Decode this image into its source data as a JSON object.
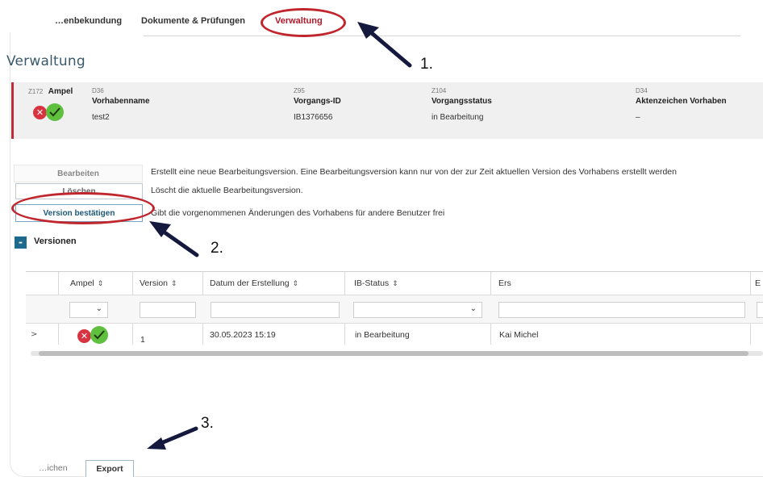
{
  "top_tabs": {
    "tab1": "…enbekundung",
    "tab2": "Dokumente & Prüfungen",
    "tab3": "Verwaltung"
  },
  "page_title": "Verwaltung",
  "info": {
    "ampel_id": "Z172",
    "ampel_label": "Ampel",
    "name_id": "D36",
    "name_label": "Vorhabenname",
    "name_value": "test2",
    "vorgang_id": "Z95",
    "vorgang_label": "Vorgangs-ID",
    "vorgang_value": "IB1376656",
    "status_id": "Z104",
    "status_label": "Vorgangsstatus",
    "status_value": "in Bearbeitung",
    "akten_id": "D34",
    "akten_label": "Aktenzeichen Vorhaben",
    "akten_value": "–"
  },
  "actions": {
    "edit_label": "Bearbeiten",
    "edit_desc": "Erstellt eine neue Bearbeitungsversion. Eine Bearbeitungsversion kann nur von der zur Zeit aktuellen Version des Vorhabens erstellt werden",
    "delete_label": "Löschen",
    "delete_desc": "Löscht die aktuelle Bearbeitungsversion.",
    "confirm_label": "Version bestätigen",
    "confirm_desc": "Gibt die vorgenommenen Änderungen des Vorhabens für andere Benutzer frei"
  },
  "versions": {
    "toggle": "-",
    "title": "Versionen",
    "columns": {
      "ampel": "Ampel",
      "version": "Version",
      "datum": "Datum der Erstellung",
      "ibstatus": "IB-Status",
      "ers": "Ers",
      "more": "E"
    },
    "sort_glyph": "⇕",
    "row": {
      "expander": ">",
      "version": "1",
      "datum": "30.05.2023 15:19",
      "ibstatus": "in Bearbeitung",
      "ers": "Kai Michel"
    }
  },
  "bottom_tabs": {
    "left": "…ichen",
    "export": "Export"
  },
  "annotations": {
    "n1": "1.",
    "n2": "2.",
    "n3": "3.",
    "arrow_color": "#15193d",
    "circle_color": "#c0262d"
  },
  "colors": {
    "accent": "#1d6a8e",
    "active_tab": "#b3192a",
    "ampel_red": "#d83341",
    "ampel_green": "#5fbf3f",
    "info_border": "#c22a3a"
  },
  "icons": {
    "ampel_red": "x-circle-icon",
    "ampel_green": "check-circle-icon",
    "dropdown": "chevron-down-icon",
    "arrow": "arrow-annotation-icon"
  }
}
